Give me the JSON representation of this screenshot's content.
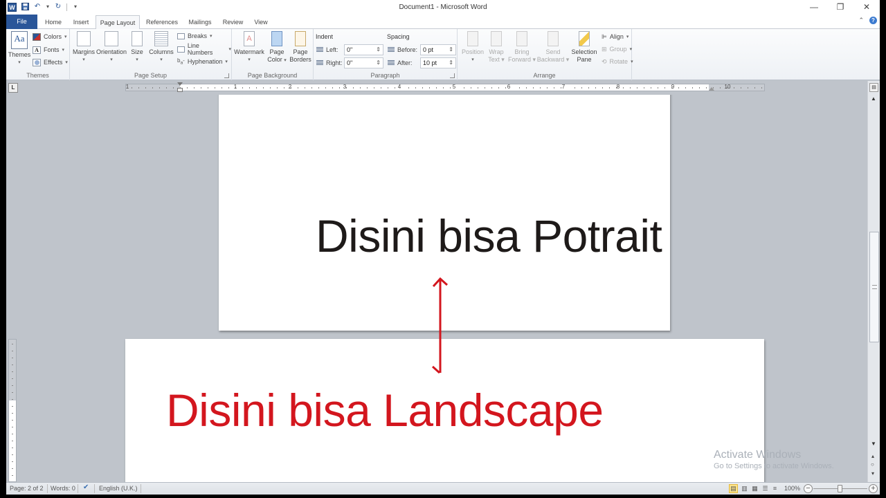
{
  "window": {
    "title": "Document1  -  Microsoft Word",
    "minimize": "—",
    "restore": "❐",
    "close": "✕"
  },
  "qat": {
    "app_icon": "W",
    "save": "💾",
    "undo": "↶",
    "undo_dd": "▾",
    "redo": "↻",
    "customize": "▾"
  },
  "tabs": [
    {
      "label": "File"
    },
    {
      "label": "Home"
    },
    {
      "label": "Insert"
    },
    {
      "label": "Page Layout",
      "active": true
    },
    {
      "label": "References"
    },
    {
      "label": "Mailings"
    },
    {
      "label": "Review"
    },
    {
      "label": "View"
    }
  ],
  "help": {
    "collapse": "⌃",
    "help": "?"
  },
  "ribbon": {
    "themes": {
      "group_label": "Themes",
      "themes_btn": "Themes",
      "colors": "Colors",
      "fonts": "Fonts",
      "effects": "Effects"
    },
    "page_setup": {
      "group_label": "Page Setup",
      "margins": "Margins",
      "orientation": "Orientation",
      "size": "Size",
      "columns": "Columns",
      "breaks": "Breaks",
      "line_numbers": "Line Numbers",
      "hyphenation": "Hyphenation"
    },
    "page_background": {
      "group_label": "Page Background",
      "watermark": "Watermark",
      "page_color_1": "Page",
      "page_color_2": "Color",
      "page_borders_1": "Page",
      "page_borders_2": "Borders"
    },
    "paragraph": {
      "group_label": "Paragraph",
      "indent_label": "Indent",
      "left_label": "Left:",
      "left_value": "0\"",
      "right_label": "Right:",
      "right_value": "0\"",
      "spacing_label": "Spacing",
      "before_label": "Before:",
      "before_value": "0 pt",
      "after_label": "After:",
      "after_value": "10 pt"
    },
    "arrange": {
      "group_label": "Arrange",
      "position": "Position",
      "wrap_1": "Wrap",
      "wrap_2": "Text",
      "bring_1": "Bring",
      "bring_2": "Forward",
      "send_1": "Send",
      "send_2": "Backward",
      "selection_1": "Selection",
      "selection_2": "Pane",
      "align": "Align",
      "group": "Group",
      "rotate": "Rotate"
    }
  },
  "ruler": {
    "tab_selector": "L",
    "numbers": [
      "1",
      "1",
      "2",
      "3",
      "4",
      "5",
      "6",
      "7",
      "8",
      "9",
      "10"
    ]
  },
  "document": {
    "page1_text": "Disini bisa Potrait",
    "page2_text": "Disini bisa Landscape",
    "page1_text_color": "#1e1a19",
    "page2_text_color": "#d3161e",
    "arrow_color": "#d3161e"
  },
  "watermark": {
    "line1": "Activate Windows",
    "line2": "Go to Settings to activate Windows."
  },
  "statusbar": {
    "page": "Page: 2 of 2",
    "words": "Words: 0",
    "proofing_icon": "✔",
    "language": "English (U.K.)",
    "zoom": "100%",
    "zoom_out": "−",
    "zoom_in": "+",
    "zoom_percent": 100
  }
}
